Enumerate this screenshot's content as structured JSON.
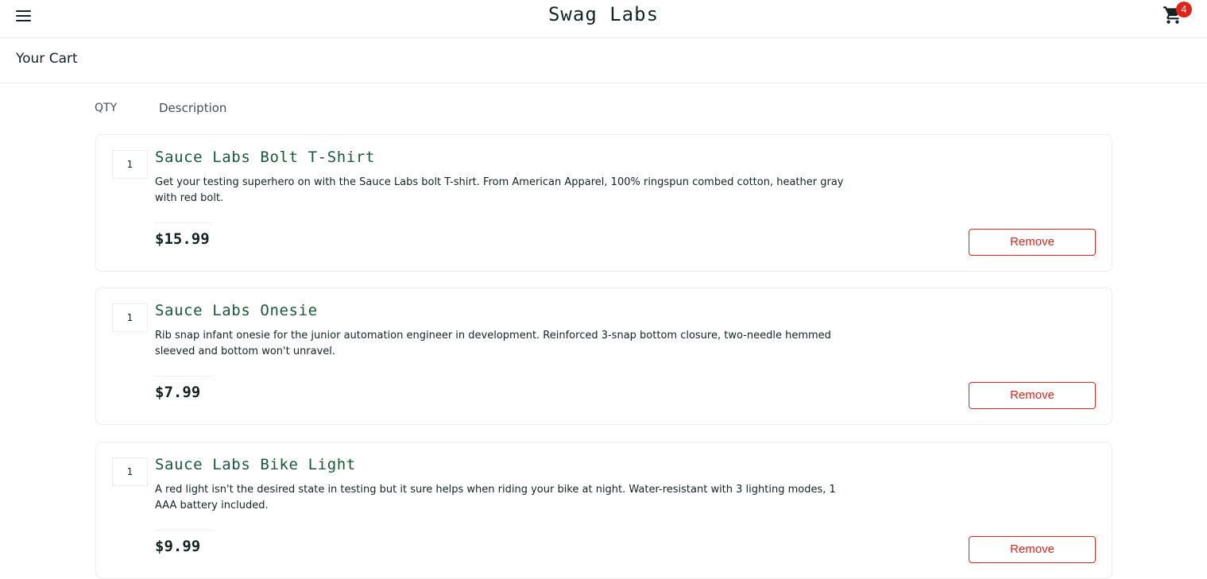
{
  "header": {
    "app_title": "Swag Labs",
    "cart_count": "4",
    "menu_icon": "hamburger-menu-icon",
    "cart_icon": "shopping-cart-icon"
  },
  "secondary_header": {
    "title": "Your Cart"
  },
  "columns": {
    "qty": "QTY",
    "description": "Description"
  },
  "cart_items": [
    {
      "qty": "1",
      "name": "Sauce Labs Bolt T-Shirt",
      "description": "Get your testing superhero on with the Sauce Labs bolt T-shirt. From American Apparel, 100% ringspun combed cotton, heather gray with red bolt.",
      "price": "$15.99",
      "remove_label": "Remove"
    },
    {
      "qty": "1",
      "name": "Sauce Labs Onesie",
      "description": "Rib snap infant onesie for the junior automation engineer in development. Reinforced 3-snap bottom closure, two-needle hemmed sleeved and bottom won't unravel.",
      "price": "$7.99",
      "remove_label": "Remove"
    },
    {
      "qty": "1",
      "name": "Sauce Labs Bike Light",
      "description": "A red light isn't the desired state in testing but it sure helps when riding your bike at night. Water-resistant with 3 lighting modes, 1 AAA battery included.",
      "price": "$9.99",
      "remove_label": "Remove"
    }
  ],
  "colors": {
    "accent_green": "#18583a",
    "remove_red": "#e2231a",
    "badge_red": "#e2231a",
    "text_dark": "#132322",
    "border": "#ededed"
  }
}
